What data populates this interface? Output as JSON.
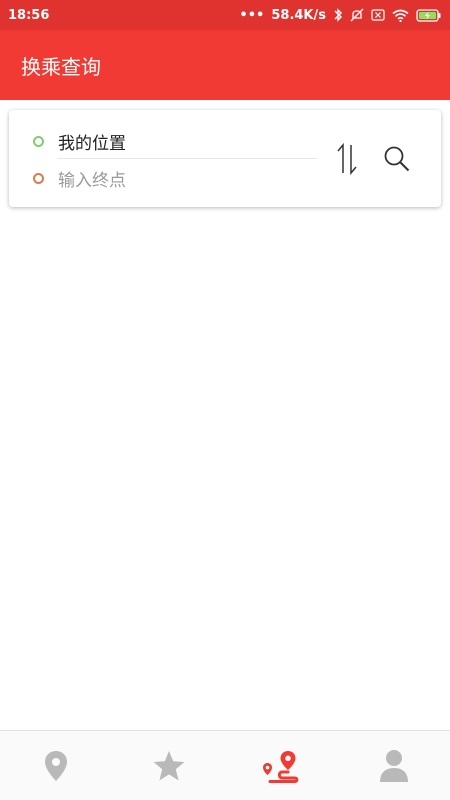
{
  "status_bar": {
    "time": "18:56",
    "net_speed": "58.4K/s",
    "icons": [
      "bluetooth-icon",
      "mute-icon",
      "sim-icon",
      "wifi-icon",
      "battery-charging-icon"
    ]
  },
  "app_bar": {
    "title": "换乘查询"
  },
  "route_card": {
    "start_label": "我的位置",
    "end_placeholder": "输入终点",
    "swap_icon": "swap-vertical-icon",
    "search_icon": "search-icon"
  },
  "bottom_nav": {
    "items": [
      {
        "icon": "location-pin-icon",
        "active": false
      },
      {
        "icon": "star-icon",
        "active": false
      },
      {
        "icon": "route-icon",
        "active": true
      },
      {
        "icon": "person-icon",
        "active": false
      }
    ]
  },
  "colors": {
    "status_bar": "#e0332f",
    "app_bar": "#f03a33",
    "start_dot": "#7fcf6e",
    "end_dot": "#e07a48",
    "nav_active": "#f03a33",
    "nav_inactive": "#b9b9b9"
  }
}
